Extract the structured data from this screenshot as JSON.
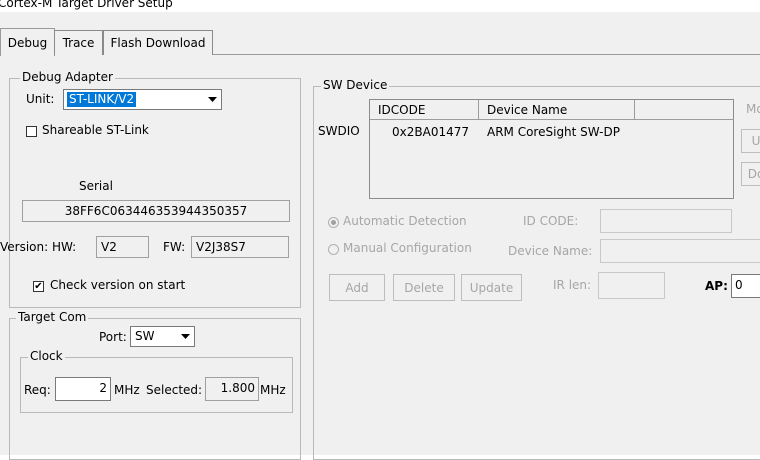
{
  "window": {
    "title": "Cortex-M Target Driver Setup"
  },
  "tabs": [
    {
      "label": "Debug",
      "active": true
    },
    {
      "label": "Trace",
      "active": false
    },
    {
      "label": "Flash Download",
      "active": false
    }
  ],
  "debug_adapter": {
    "group_label": "Debug Adapter",
    "unit_label": "Unit:",
    "unit_value": "ST-LINK/V2",
    "shareable_label": "Shareable ST-Link",
    "shareable_checked": false,
    "serial_label": "Serial",
    "serial_value": "38FF6C063446353944350357",
    "version_hw_label": "Version: HW:",
    "version_hw_value": "V2",
    "version_fw_label": "FW:",
    "version_fw_value": "V2J38S7",
    "check_version_label": "Check version on start",
    "check_version_checked": true,
    "check_mark": "✔"
  },
  "target_com": {
    "group_label": "Target Com",
    "port_label": "Port:",
    "port_value": "SW",
    "clock": {
      "group_label": "Clock",
      "req_label": "Req:",
      "req_value": "2",
      "req_unit": "MHz",
      "selected_label": "Selected:",
      "selected_value": "1.800",
      "selected_unit": "MHz"
    }
  },
  "sw_device": {
    "group_label": "SW Device",
    "columns": [
      "IDCODE",
      "Device Name"
    ],
    "row_header": "SWDIO",
    "rows": [
      {
        "idcode": "0x2BA01477",
        "device_name": "ARM CoreSight SW-DP"
      }
    ],
    "side_label": "Mo",
    "side_buttons": [
      "U",
      "Do"
    ],
    "auto_detect_label": "Automatic Detection",
    "manual_config_label": "Manual Configuration",
    "id_code_label": "ID CODE:",
    "device_name_label": "Device Name:",
    "ir_len_label": "IR len:",
    "ap_label": "AP:",
    "ap_value": "0",
    "buttons": {
      "add": "Add",
      "delete": "Delete",
      "update": "Update"
    }
  },
  "colors": {
    "dialog_bg": "#f0f0f0",
    "selection_bg": "#0078d7",
    "disabled_text": "#a6a6a6"
  },
  "icons": {
    "dropdown": "chevron-down-icon",
    "checkbox": "checkbox-icon",
    "radio": "radio-icon"
  }
}
